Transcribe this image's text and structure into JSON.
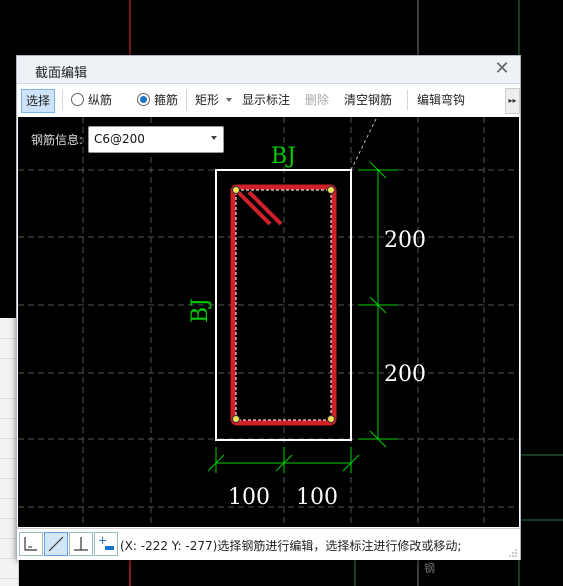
{
  "dialog": {
    "title": "截面编辑",
    "close_label": "✕"
  },
  "toolbar": {
    "select_label": "选择",
    "longitudinal_label": "纵筋",
    "stirrup_label": "箍筋",
    "shape_label": "矩形",
    "show_dim_label": "显示标注",
    "delete_label": "删除",
    "clear_label": "清空钢筋",
    "edit_hook_label": "编辑弯钩",
    "more_label": "▸▸"
  },
  "rebar_info": {
    "label": "钢筋信息:",
    "value": "C6@200"
  },
  "drawing": {
    "top_label": "BJ",
    "left_label": "BJ",
    "dim_right_top": "200",
    "dim_right_bottom": "200",
    "dim_bottom_left": "100",
    "dim_bottom_right": "100",
    "colors": {
      "section": "#ffffff",
      "stirrup": "#d0202a",
      "dimension": "#00d000",
      "label": "#00cc00",
      "grid": "#555555"
    }
  },
  "statusbar": {
    "message": "(X: -222 Y: -277)选择钢筋进行编辑，选择标注进行修改或移动;"
  },
  "background": {
    "corner_text": "钢"
  }
}
